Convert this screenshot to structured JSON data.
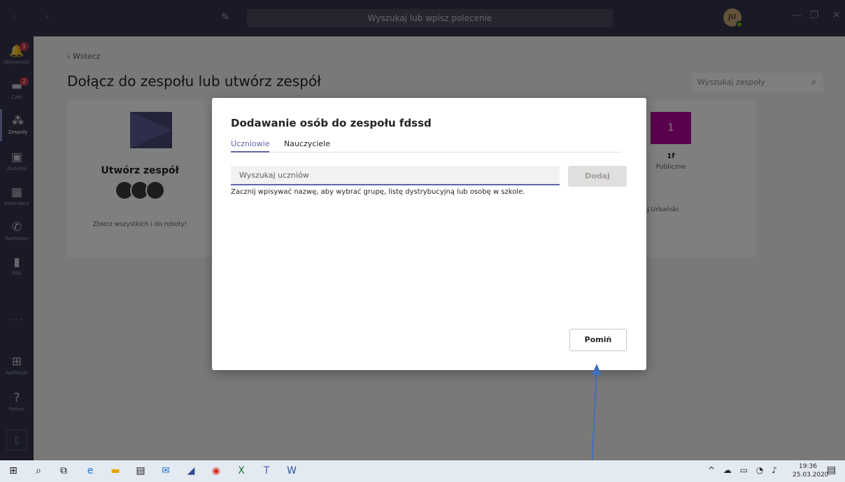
{
  "titlebar": {
    "search_placeholder": "Wyszukaj lub wpisz polecenie",
    "avatar_initials": "JU"
  },
  "rail": {
    "items": [
      {
        "label": "Aktywność",
        "badge": "1"
      },
      {
        "label": "Czat",
        "badge": "2"
      },
      {
        "label": "Zespoły"
      },
      {
        "label": "Zadania"
      },
      {
        "label": "Kalendarz"
      },
      {
        "label": "Rozmowy"
      },
      {
        "label": "Pliki"
      },
      {
        "label": "Aplikacje"
      },
      {
        "label": "Pomoc"
      }
    ]
  },
  "main": {
    "back_label": "Wstecz",
    "page_title": "Dołącz do zespołu lub utwórz zespół",
    "team_search_placeholder": "Wyszukaj zespoły",
    "create_card": {
      "title": "Utwórz zespół",
      "subtitle": "Zbierz wszystkich i do roboty!"
    },
    "team_card": {
      "tile": "1",
      "name": "1f",
      "kind": "Publiczne",
      "owner": "ez J.Urbański"
    }
  },
  "dialog": {
    "title": "Dodawanie osób do zespołu fdssd",
    "tabs": [
      {
        "label": "Uczniowie",
        "active": true
      },
      {
        "label": "Nauczyciele",
        "active": false
      }
    ],
    "input_placeholder": "Wyszukaj uczniów",
    "add_label": "Dodaj",
    "hint": "Zacznij wpisywać nazwę, aby wybrać grupę, listę dystrybucyjną lub osobę w szkole.",
    "skip_label": "Pomiń"
  },
  "taskbar": {
    "time": "19:36",
    "date": "25.03.2020"
  },
  "colors": {
    "accent": "#6264a7",
    "rail": "#33344a",
    "badge": "#c4314b",
    "team_tile": "#b4009e",
    "annotation_arrow": "#3f6fbf"
  }
}
